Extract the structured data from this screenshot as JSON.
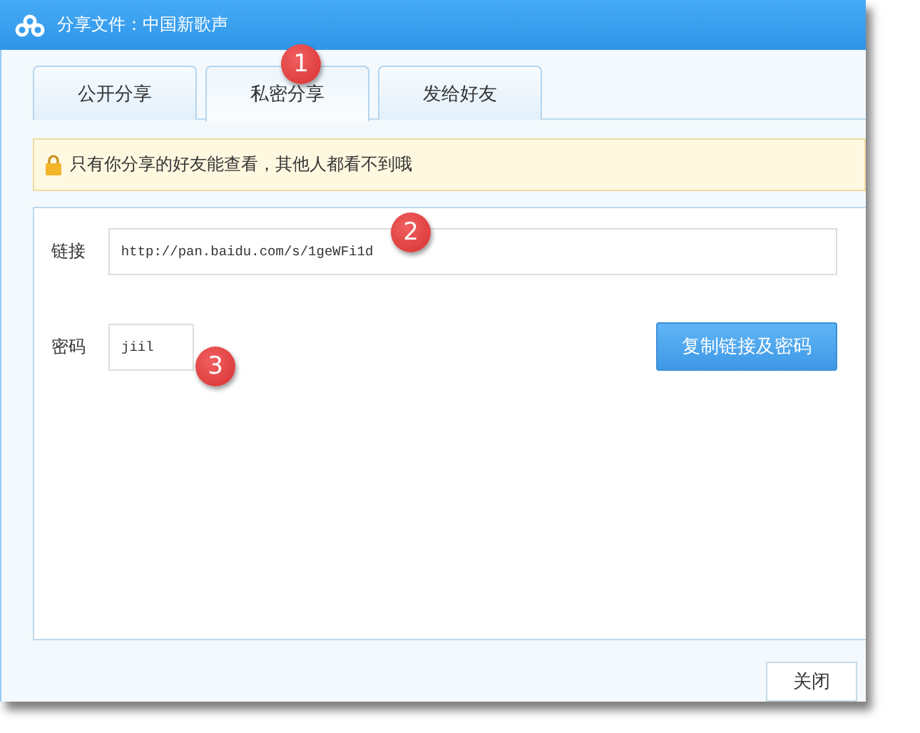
{
  "window": {
    "title": "分享文件：中国新歌声"
  },
  "tabs": [
    {
      "label": "公开分享",
      "selected": false
    },
    {
      "label": "私密分享",
      "selected": true
    },
    {
      "label": "发给好友",
      "selected": false
    }
  ],
  "notice": "只有你分享的好友能查看，其他人都看不到哦",
  "link": {
    "label": "链接",
    "value": "http://pan.baidu.com/s/1geWFi1d"
  },
  "password": {
    "label": "密码",
    "value": "jiil"
  },
  "copy_button": "复制链接及密码",
  "close_button": "关闭",
  "callouts": [
    "1",
    "2",
    "3"
  ]
}
